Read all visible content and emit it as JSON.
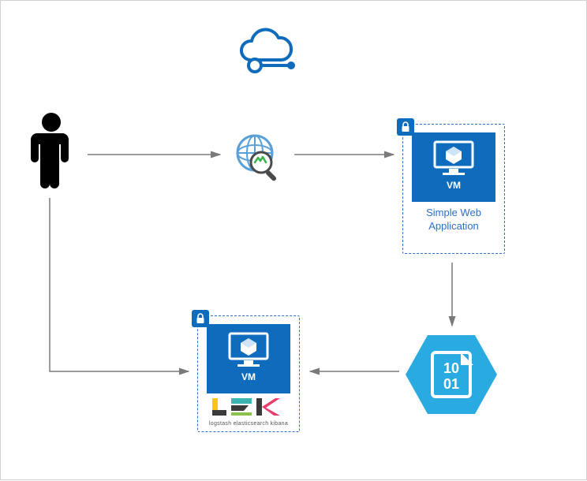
{
  "nodes": {
    "cloud": {
      "name": "azure-cloud-icon"
    },
    "user": {
      "name": "user-icon"
    },
    "globe": {
      "name": "web-monitor-icon"
    },
    "app_vm": {
      "tile_label": "VM",
      "caption_line1": "Simple Web",
      "caption_line2": "Application"
    },
    "elk_vm": {
      "tile_label": "VM",
      "logo_word": "LEK",
      "logo_sub": "logstash elasticsearch kibana"
    },
    "data_hex": {
      "row1": "10",
      "row2": "01"
    }
  },
  "colors": {
    "azure_blue": "#0f6cbd",
    "azure_light": "#29abe2",
    "arrow": "#7a7a7a",
    "dash": "#2f6fc6"
  }
}
